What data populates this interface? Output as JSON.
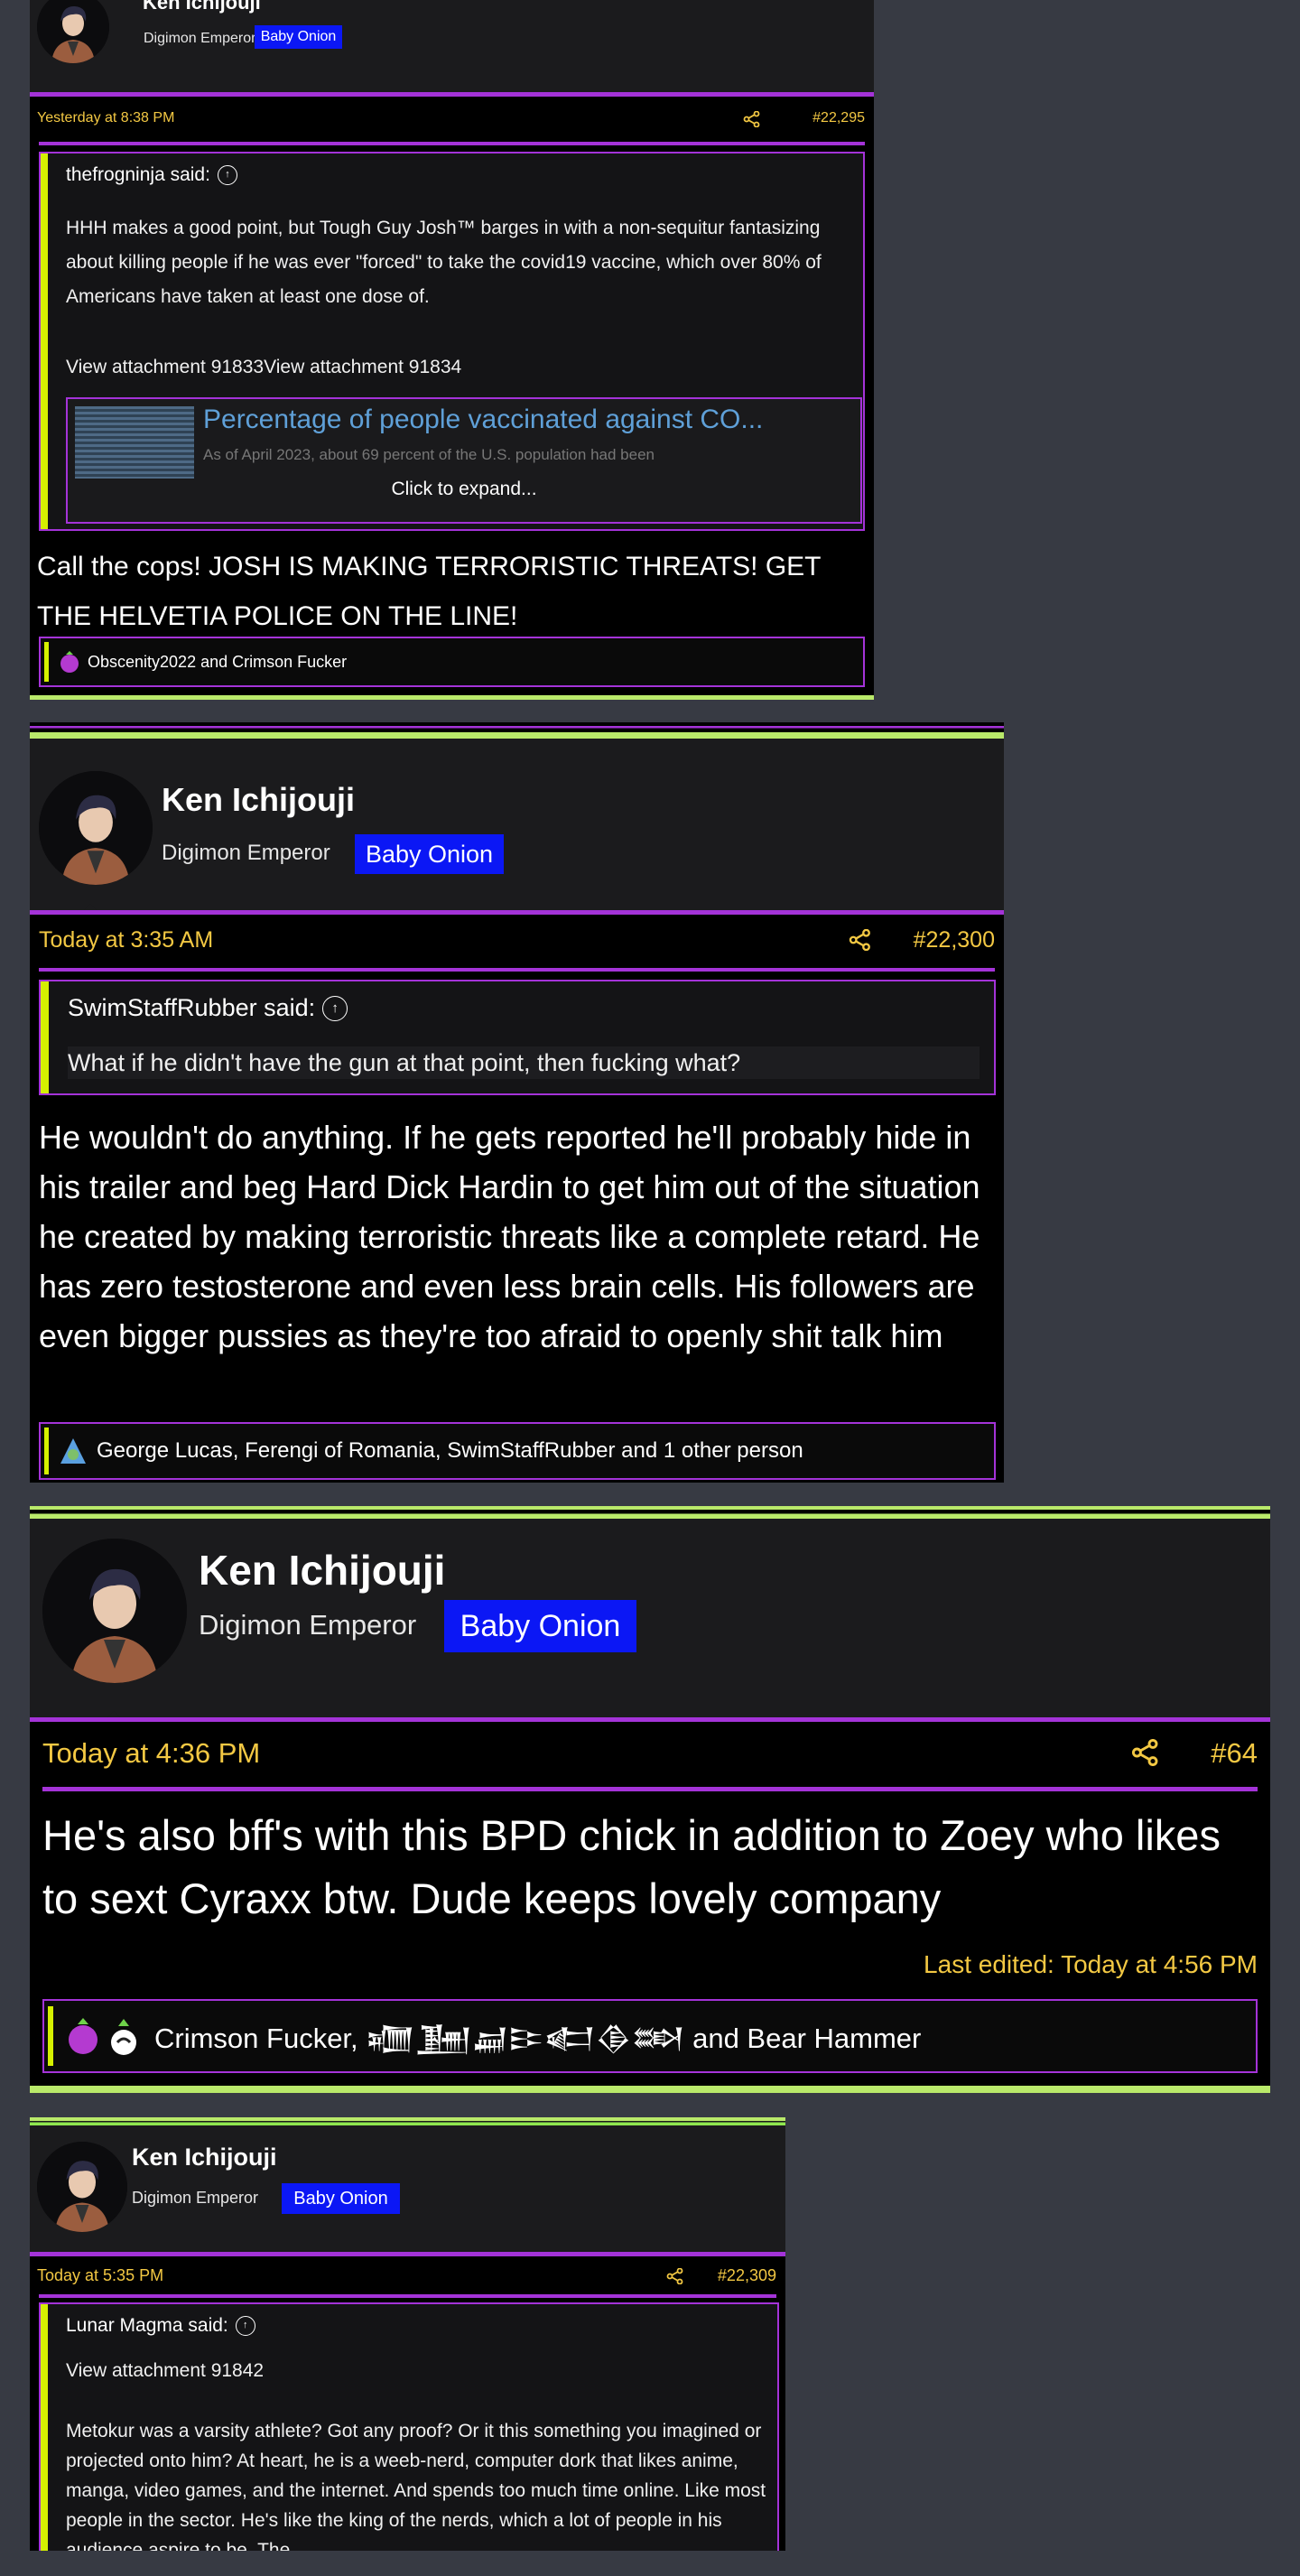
{
  "posts": [
    {
      "username": "Ken Ichijouji",
      "user_title": "Digimon Emperor",
      "badge": "Baby Onion",
      "date": "Yesterday at 8:38 PM",
      "post_number": "#22,295",
      "quote": {
        "author": "thefrogninja said:",
        "text": "HHH makes a good point, but Tough Guy Josh™ barges in with a non-sequitur fantasizing about killing people if he was ever \"forced\" to take the covid19 vaccine, which over 80% of Americans have taken at least one dose of.",
        "attachments": "View attachment 91833View attachment 91834",
        "embed_title": "Percentage of people vaccinated against CO...",
        "embed_subtitle": "As of April 2023, about 69 percent of the U.S. population had been",
        "expand_label": "Click to expand..."
      },
      "body": "Call the cops! JOSH IS MAKING TERRORISTIC THREATS! GET THE HELVETIA POLICE ON THE LINE!",
      "reactions": "Obscenity2022 and Crimson Fucker"
    },
    {
      "username": "Ken Ichijouji",
      "user_title": "Digimon Emperor",
      "badge": "Baby Onion",
      "date": "Today at 3:35 AM",
      "post_number": "#22,300",
      "quote": {
        "author": "SwimStaffRubber said:",
        "text": "What if he didn't have the gun at that point, then fucking what?"
      },
      "body": "He wouldn't do anything. If he gets reported he'll probably hide in his trailer and beg Hard Dick Hardin to get him out of the situation he created by making terroristic threats like a complete retard. He has zero testosterone and even less brain cells. His followers are even bigger pussies as they're too afraid to openly shit talk him",
      "reactions": "George Lucas, Ferengi of Romania, SwimStaffRubber and 1 other person"
    },
    {
      "username": "Ken Ichijouji",
      "user_title": "Digimon Emperor",
      "badge": "Baby Onion",
      "date": "Today at 4:36 PM",
      "post_number": "#64",
      "body": "He's also bff's with this BPD chick in addition to Zoey who likes to sext Cyraxx btw. Dude keeps lovely company",
      "edited": "Last edited: Today at 4:56 PM",
      "reactions": "Crimson Fucker, 𒁾𒂞𒃷𒄿𒅗𒆠𒇷 and Bear Hammer"
    },
    {
      "username": "Ken Ichijouji",
      "user_title": "Digimon Emperor",
      "badge": "Baby Onion",
      "date": "Today at 5:35 PM",
      "post_number": "#22,309",
      "quote": {
        "author": "Lunar Magma said:",
        "attachments": "View attachment 91842",
        "text": "Metokur was a varsity athlete? Got any proof? Or it this something you imagined or projected onto him? At heart, he is a weeb-nerd, computer dork that likes anime, manga, video games, and the internet. And spends too much time online. Like most people in the sector. He's like the king of the nerds, which a lot of people in his audience aspire to be. The"
      }
    }
  ],
  "colors": {
    "page_bg": "#373a43",
    "post_bg": "#000000",
    "header_bg": "#1b1b1d",
    "accent_purple": "#a433d8",
    "date_gold": "#f3c843",
    "badge_blue": "#0b17f5",
    "quote_bar": "#d5f000",
    "link_blue": "#5fa0d8"
  }
}
